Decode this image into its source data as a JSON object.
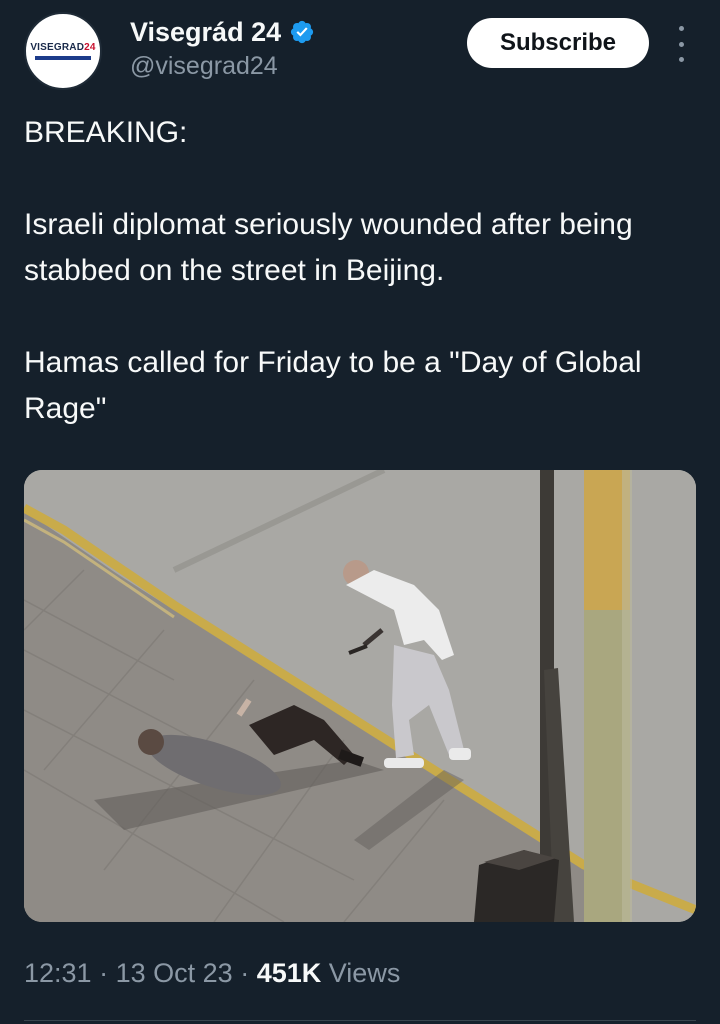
{
  "account": {
    "display_name": "Visegrád 24",
    "handle": "@visegrad24",
    "avatar_text_main": "VISEGRAD",
    "avatar_text_accent": "24",
    "verified_icon": "verified-badge-icon",
    "brand_color": "#1d9bf0"
  },
  "actions": {
    "subscribe_label": "Subscribe",
    "more_icon": "more-vertical-icon"
  },
  "tweet": {
    "lines": [
      "BREAKING:",
      "Israeli diplomat seriously wounded after being stabbed on the street in Beijing.",
      "Hamas called for Friday to be a \"Day of Global Rage\""
    ]
  },
  "media": {
    "type": "video-still"
  },
  "meta": {
    "time": "12:31",
    "separator": "·",
    "date": "13 Oct 23",
    "views_count": "451K",
    "views_label": "Views"
  },
  "colors": {
    "background": "#15202b",
    "text_primary": "#f7f9f9",
    "text_secondary": "#8b98a5",
    "divider": "#38444d"
  }
}
